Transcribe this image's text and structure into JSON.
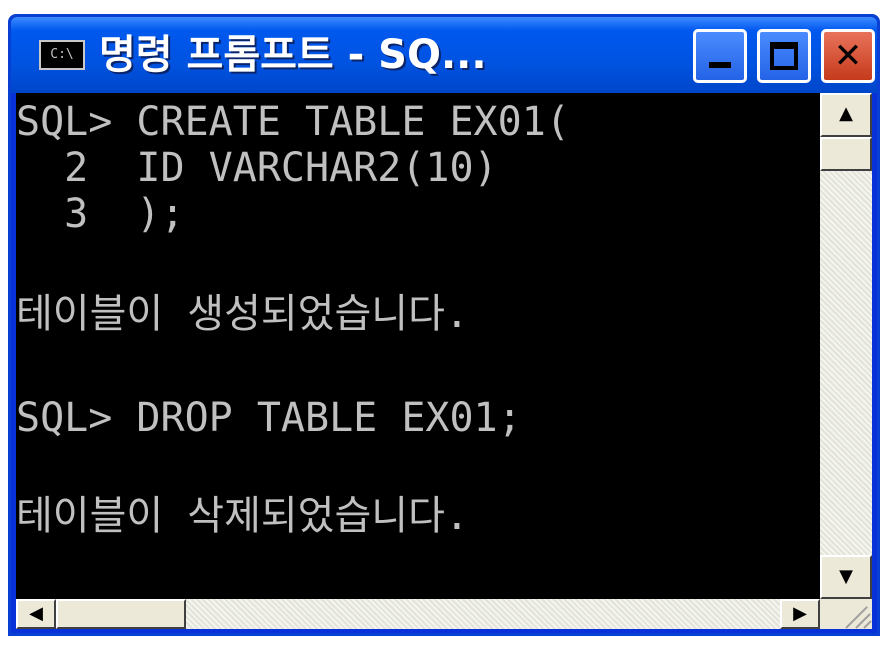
{
  "window": {
    "title": "명령 프롬프트 - SQ...",
    "app_icon": "console-icon",
    "app_icon_text": "C:\\",
    "controls": {
      "minimize_icon": "minimize-icon",
      "maximize_icon": "maximize-icon",
      "close_icon": "close-icon",
      "close_glyph": "✕"
    }
  },
  "console": {
    "lines": [
      "SQL> CREATE TABLE EX01(",
      "  2  ID VARCHAR2(10)",
      "  3  );",
      "",
      "테이블이 생성되었습니다.",
      "",
      "SQL> DROP TABLE EX01;",
      "",
      "테이블이 삭제되었습니다."
    ]
  },
  "scrollbars": {
    "up_glyph": "▲",
    "down_glyph": "▼",
    "left_glyph": "◀",
    "right_glyph": "▶"
  },
  "colors": {
    "titlebar": "#0058ee",
    "console_bg": "#000000",
    "console_fg": "#c0c0c0",
    "close_button": "#c63a1c"
  }
}
